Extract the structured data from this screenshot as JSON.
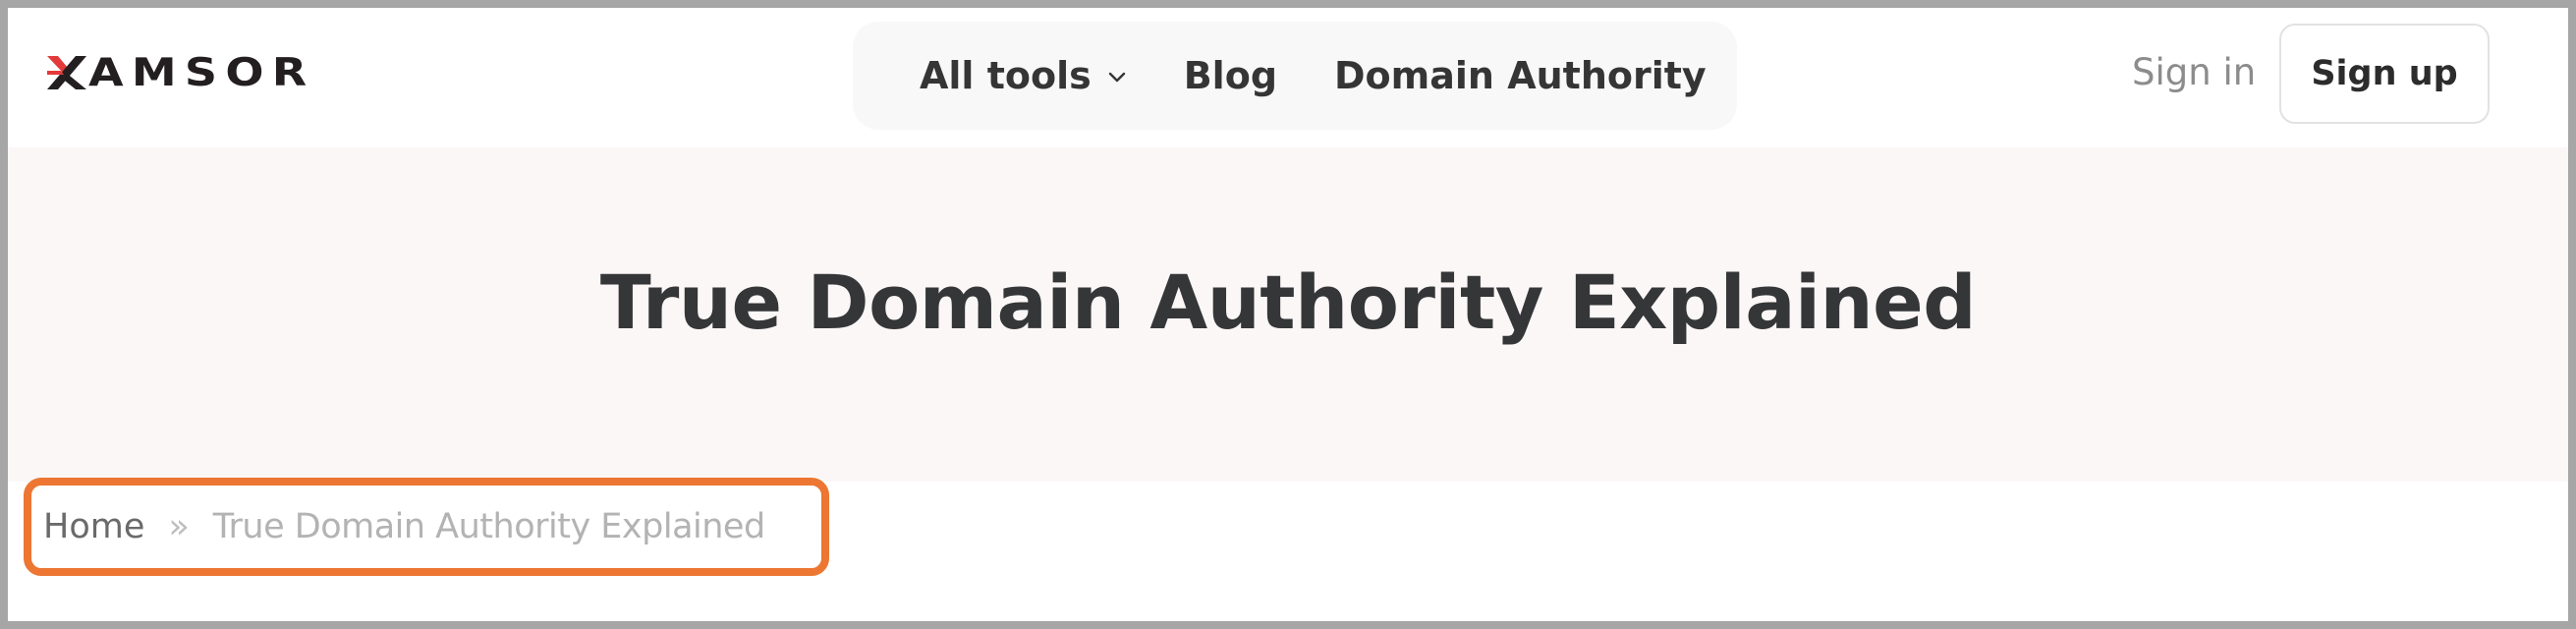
{
  "header": {
    "logo_text": "XAMSOR",
    "logo_letters_after_x": "AMSOR",
    "logo_accent_color": "#e23a3a",
    "nav": {
      "all_tools": "All tools",
      "blog": "Blog",
      "domain_authority": "Domain Authority"
    },
    "sign_in": "Sign in",
    "sign_up": "Sign up"
  },
  "hero": {
    "title": "True Domain Authority Explained"
  },
  "breadcrumb": {
    "home": "Home",
    "separator": "»",
    "current": "True Domain Authority Explained",
    "highlight_color": "#ec7632"
  }
}
